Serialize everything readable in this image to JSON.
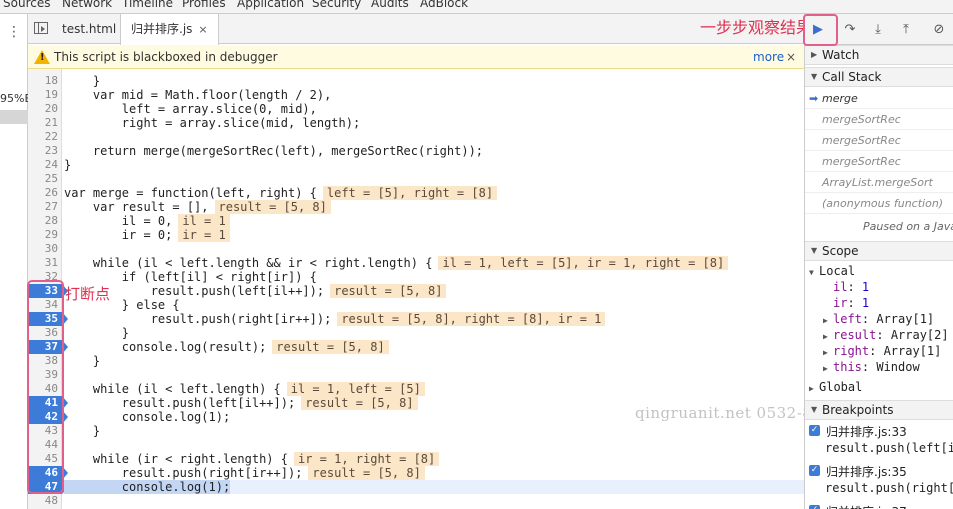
{
  "menu": [
    "Sources",
    "Network",
    "Timeline",
    "Profiles",
    "Application",
    "Security",
    "Audits",
    "AdBlock"
  ],
  "left_panel": {
    "percent_text": "95%E"
  },
  "tabs": [
    {
      "label": "test.html",
      "active": false
    },
    {
      "label": "归并排序.js",
      "active": true,
      "close": "×"
    }
  ],
  "banner": {
    "message": "This script is blackboxed in debugger",
    "more": "more",
    "close": "×",
    "warn_glyph": "!"
  },
  "code_lines": [
    {
      "n": "18",
      "code": "    }",
      "bp": false
    },
    {
      "n": "19",
      "code": "    var mid = Math.floor(length / 2),",
      "bp": false
    },
    {
      "n": "20",
      "code": "        left = array.slice(0, mid),",
      "bp": false
    },
    {
      "n": "21",
      "code": "        right = array.slice(mid, length);",
      "bp": false
    },
    {
      "n": "22",
      "code": "",
      "bp": false
    },
    {
      "n": "23",
      "code": "    return merge(mergeSortRec(left), mergeSortRec(right));",
      "bp": false
    },
    {
      "n": "24",
      "code": "}",
      "bp": false
    },
    {
      "n": "25",
      "code": "",
      "bp": false
    },
    {
      "n": "26",
      "code": "var merge = function(left, right) {",
      "bp": false,
      "inline": "left = [5], right = [8]"
    },
    {
      "n": "27",
      "code": "    var result = [],",
      "bp": false,
      "inline": "result = [5, 8]"
    },
    {
      "n": "28",
      "code": "        il = 0,",
      "bp": false,
      "inline": "il = 1"
    },
    {
      "n": "29",
      "code": "        ir = 0;",
      "bp": false,
      "inline": "ir = 1"
    },
    {
      "n": "30",
      "code": "",
      "bp": false
    },
    {
      "n": "31",
      "code": "    while (il < left.length && ir < right.length) {",
      "bp": false,
      "inline": "il = 1, left = [5], ir = 1, right = [8]"
    },
    {
      "n": "32",
      "code": "        if (left[il] < right[ir]) {",
      "bp": false
    },
    {
      "n": "33",
      "code": "            result.push(left[il++]);",
      "bp": true,
      "inline": "result = [5, 8]"
    },
    {
      "n": "34",
      "code": "        } else {",
      "bp": false
    },
    {
      "n": "35",
      "code": "            result.push(right[ir++]);",
      "bp": true,
      "inline": "result = [5, 8], right = [8], ir = 1"
    },
    {
      "n": "36",
      "code": "        }",
      "bp": false
    },
    {
      "n": "37",
      "code": "        console.log(result);",
      "bp": true,
      "inline": "result = [5, 8]"
    },
    {
      "n": "38",
      "code": "    }",
      "bp": false
    },
    {
      "n": "39",
      "code": "",
      "bp": false
    },
    {
      "n": "40",
      "code": "    while (il < left.length) {",
      "bp": false,
      "inline": "il = 1, left = [5]"
    },
    {
      "n": "41",
      "code": "        result.push(left[il++]);",
      "bp": true,
      "inline": "result = [5, 8]"
    },
    {
      "n": "42",
      "code": "        console.log(1);",
      "bp": true
    },
    {
      "n": "43",
      "code": "    }",
      "bp": false
    },
    {
      "n": "44",
      "code": "",
      "bp": false
    },
    {
      "n": "45",
      "code": "    while (ir < right.length) {",
      "bp": false,
      "inline": "ir = 1, right = [8]"
    },
    {
      "n": "46",
      "code": "        result.push(right[ir++]);",
      "bp": true,
      "inline": "result = [5, 8]"
    },
    {
      "n": "47",
      "code": "        console.log(1);",
      "bp": true,
      "current": true
    },
    {
      "n": "48",
      "code": "",
      "bp": false
    }
  ],
  "annotations": {
    "breakpoints": "打断点",
    "step": "一步步观察结果"
  },
  "watermark": "qingruanit.net 0532-85025005",
  "sidebar": {
    "watch": "Watch",
    "call_stack": "Call Stack",
    "frames": [
      "merge",
      "mergeSortRec",
      "mergeSortRec",
      "mergeSortRec",
      "ArrayList.mergeSort",
      "(anonymous function)"
    ],
    "paused": "Paused on a Java",
    "scope": "Scope",
    "local": "Local",
    "scope_vars": [
      {
        "k": "il",
        "v": "1",
        "tri": false
      },
      {
        "k": "ir",
        "v": "1",
        "tri": false
      },
      {
        "k": "left",
        "v": "Array[1]",
        "tri": true
      },
      {
        "k": "result",
        "v": "Array[2]",
        "tri": true
      },
      {
        "k": "right",
        "v": "Array[1]",
        "tri": true
      },
      {
        "k": "this",
        "v": "Window",
        "tri": true
      }
    ],
    "global": "Global",
    "breakpoints": "Breakpoints",
    "bp_items": [
      {
        "file": "归并排序.js:33",
        "code": "result.push(left[il"
      },
      {
        "file": "归并排序.js:35",
        "code": "result.push(right["
      },
      {
        "file": "归并排序.js:37",
        "code": ""
      }
    ]
  }
}
